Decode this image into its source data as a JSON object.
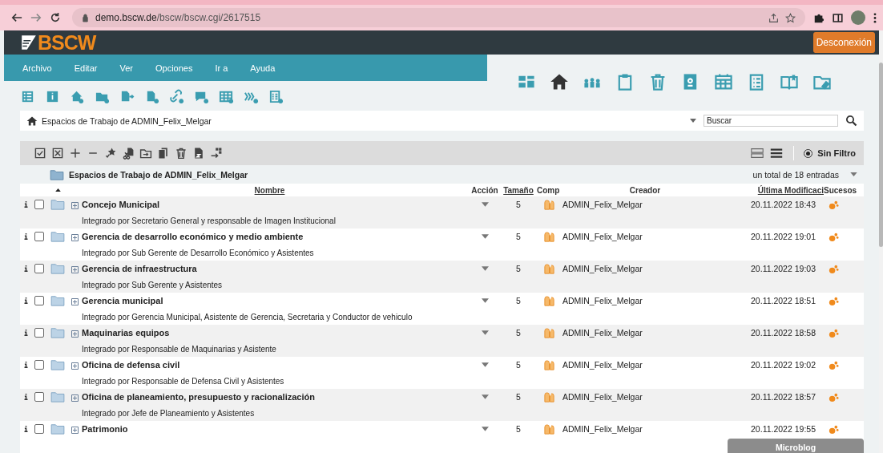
{
  "browser": {
    "host": "demo.bscw.de",
    "path": "/bscw/bscw.cgi/2617515"
  },
  "header": {
    "logo": "BSCW",
    "logout": "Desconexión"
  },
  "menu": [
    "Archivo",
    "Editar",
    "Ver",
    "Opciones",
    "Ir a",
    "Ayuda"
  ],
  "workspace_nav": [
    {
      "selected": false
    },
    {
      "selected": true
    },
    {
      "selected": false
    },
    {
      "selected": false
    },
    {
      "selected": false
    },
    {
      "selected": false
    },
    {
      "selected": false
    },
    {
      "selected": false
    },
    {
      "selected": false
    },
    {
      "selected": false
    }
  ],
  "breadcrumb": "Espacios de Trabajo de ADMIN_Felix_Melgar",
  "search": {
    "placeholder": "Buscar"
  },
  "filter": {
    "label": "Sin Filtro",
    "selected": true
  },
  "folder_title": "Espacios de Trabajo de ADMIN_Felix_Melgar",
  "entry_count": "un total de 18 entradas",
  "table": {
    "columns": [
      {
        "label": "Nombre",
        "sortable": true
      },
      {
        "label": "Acción",
        "sortable": false
      },
      {
        "label": "Tamaño",
        "sortable": true
      },
      {
        "label": "Comp",
        "sortable": false
      },
      {
        "label": "Creador",
        "sortable": false
      },
      {
        "label": "Última Modificaci",
        "sortable": true
      },
      {
        "label": "Sucesos",
        "sortable": false
      }
    ],
    "rows": [
      {
        "name": "Concejo Municipal",
        "description": "Integrado por Secretario General y responsable de Imagen Institucional",
        "size": "5",
        "creator": "ADMIN_Felix_Melgar",
        "modified": "20.11.2022 18:43",
        "checked": false
      },
      {
        "name": "Gerencia de desarrollo económico y medio ambiente",
        "description": "Integrado por Sub Gerente de Desarrollo Económico y Asistentes",
        "size": "5",
        "creator": "ADMIN_Felix_Melgar",
        "modified": "20.11.2022 19:01",
        "checked": false
      },
      {
        "name": "Gerencia de infraestructura",
        "description": "Integrado por Sub Gerente y Asistentes",
        "size": "5",
        "creator": "ADMIN_Felix_Melgar",
        "modified": "20.11.2022 19:03",
        "checked": false
      },
      {
        "name": "Gerencia municipal",
        "description": "Integrado por Gerencia Municipal, Asistente de Gerencia, Secretaria y Conductor de vehiculo",
        "size": "5",
        "creator": "ADMIN_Felix_Melgar",
        "modified": "20.11.2022 18:51",
        "checked": false
      },
      {
        "name": "Maquinarias equipos",
        "description": "Integrado por Responsable de Maquinarias y Asistente",
        "size": "5",
        "creator": "ADMIN_Felix_Melgar",
        "modified": "20.11.2022 18:58",
        "checked": false
      },
      {
        "name": "Oficina de defensa civil",
        "description": "Integrado por Responsable de Defensa Civil y Asistentes",
        "size": "5",
        "creator": "ADMIN_Felix_Melgar",
        "modified": "20.11.2022 19:02",
        "checked": false
      },
      {
        "name": "Oficina de planeamiento, presupuesto y racionalización",
        "description": "Integrado por Jefe de Planeamiento y Asistentes",
        "size": "5",
        "creator": "ADMIN_Felix_Melgar",
        "modified": "20.11.2022 18:57",
        "checked": false
      },
      {
        "name": "Patrimonio",
        "size": "5",
        "creator": "ADMIN_Felix_Melgar",
        "modified": "20.11.2022 19:55",
        "checked": false
      }
    ]
  },
  "microblog": "Microblog"
}
